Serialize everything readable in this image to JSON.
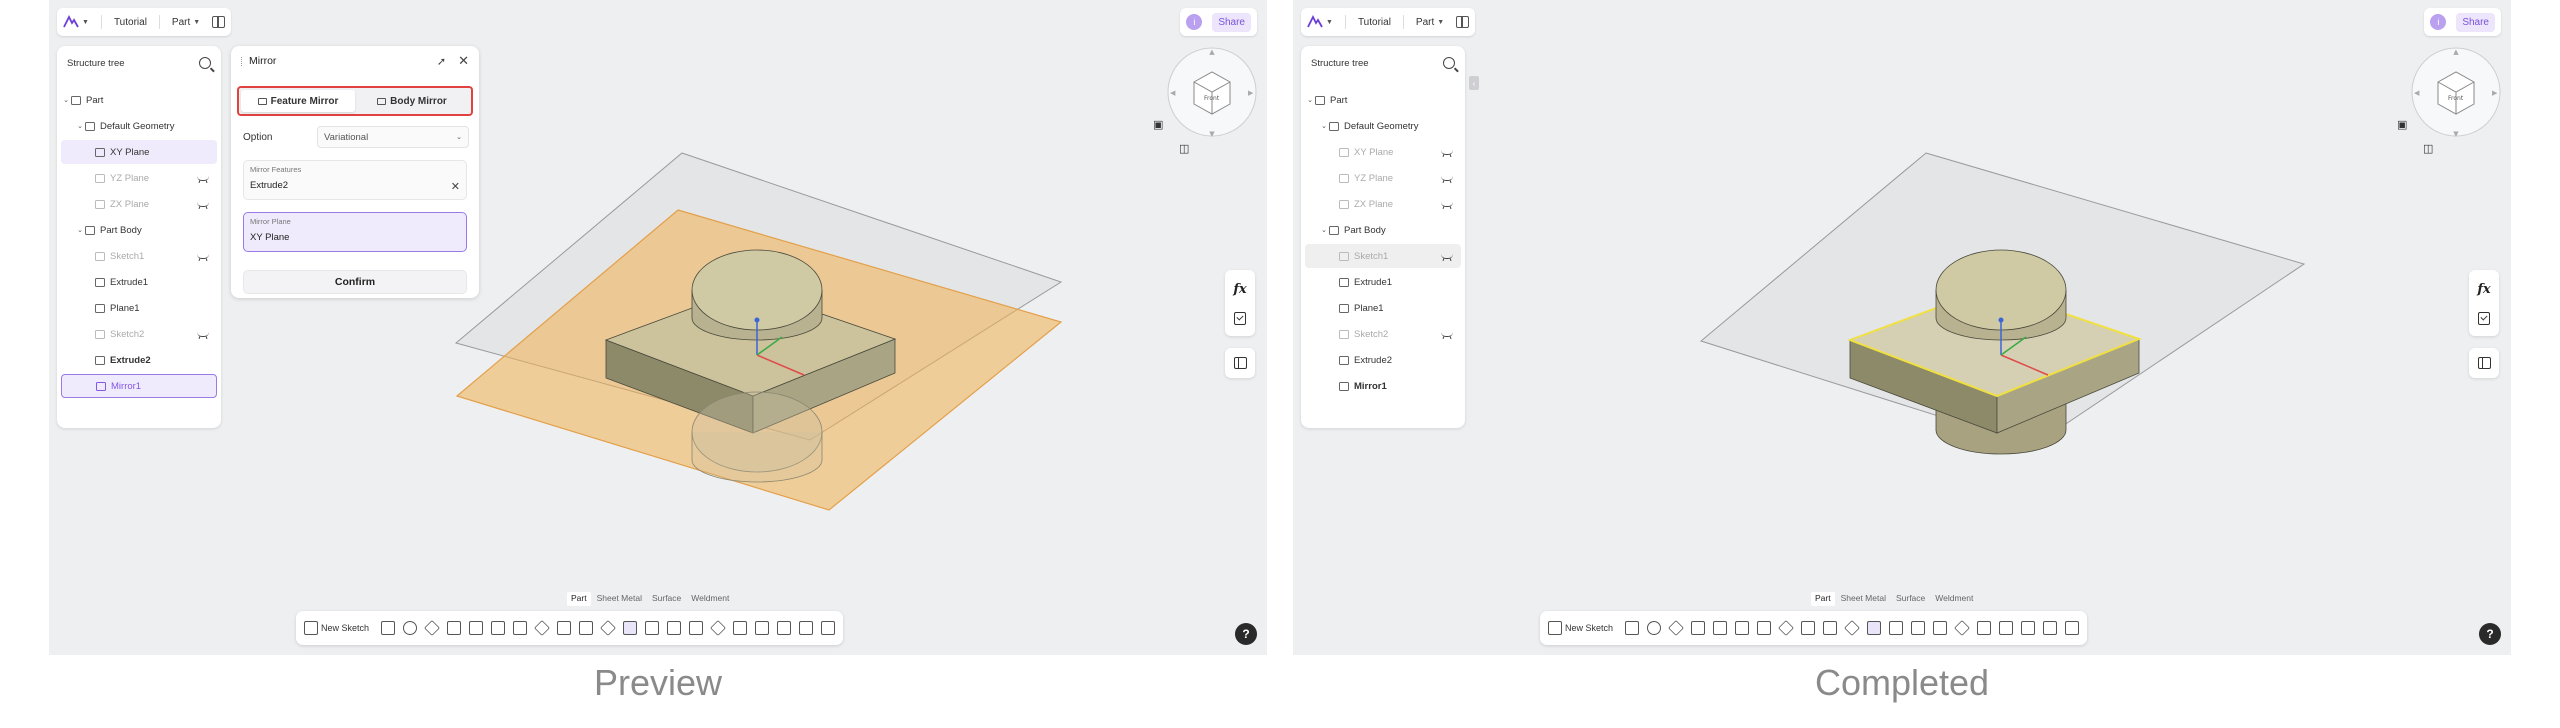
{
  "topbar": {
    "tutorial_label": "Tutorial",
    "part_label": "Part",
    "share_label": "Share",
    "user_initial": "i"
  },
  "tree": {
    "title": "Structure tree",
    "items": [
      {
        "label": "Part"
      },
      {
        "label": "Default Geometry"
      },
      {
        "label": "XY Plane"
      },
      {
        "label": "YZ Plane"
      },
      {
        "label": "ZX Plane"
      },
      {
        "label": "Part Body"
      },
      {
        "label": "Sketch1"
      },
      {
        "label": "Extrude1"
      },
      {
        "label": "Plane1"
      },
      {
        "label": "Sketch2"
      },
      {
        "label": "Extrude2"
      },
      {
        "label": "Mirror1"
      }
    ]
  },
  "mirror": {
    "title": "Mirror",
    "feature_mirror_label": "Feature Mirror",
    "body_mirror_label": "Body Mirror",
    "option_label": "Option",
    "option_value": "Variational",
    "mirror_features_label": "Mirror Features",
    "mirror_features_value": "Extrude2",
    "mirror_plane_label": "Mirror Plane",
    "mirror_plane_value": "XY Plane",
    "confirm_label": "Confirm"
  },
  "bottom": {
    "tabs": [
      "Part",
      "Sheet Metal",
      "Surface",
      "Weldment"
    ],
    "new_sketch_label": "New Sketch"
  },
  "side": {
    "fx_label": "fx",
    "help_label": "?"
  },
  "navcube": {
    "front_label": "Front"
  },
  "captions": {
    "left": "Preview",
    "right": "Completed"
  },
  "colors": {
    "accent": "#8457e6",
    "highlight_box": "#e0433f",
    "preview_plane": "#f0b55a",
    "edge_highlight": "#f0e040"
  }
}
